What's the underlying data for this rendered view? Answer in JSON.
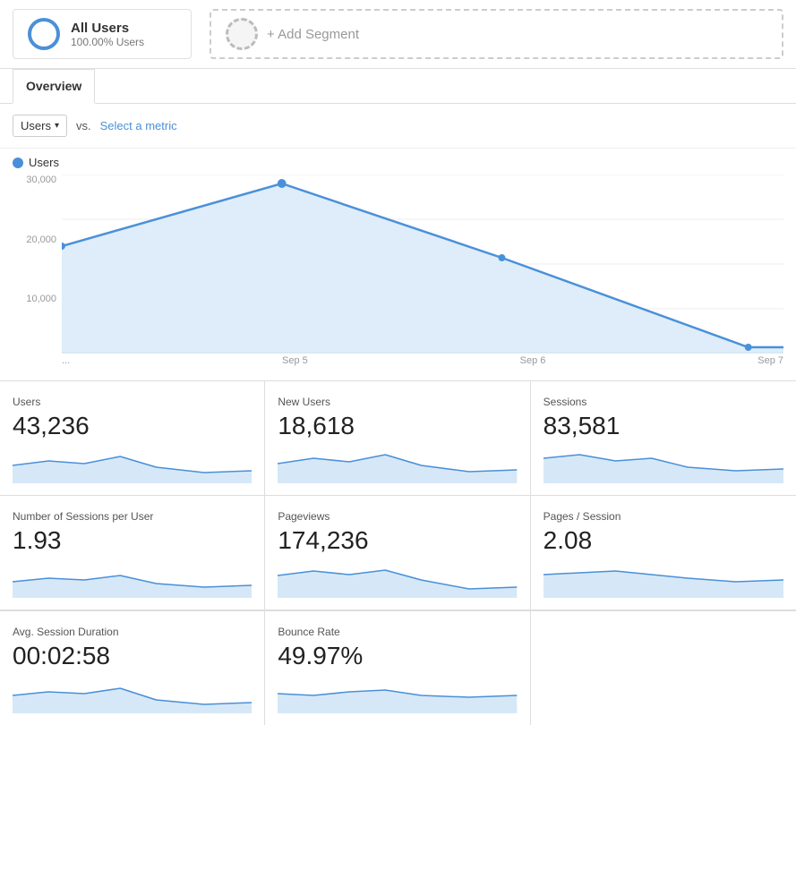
{
  "segments": {
    "all_users": {
      "name": "All Users",
      "pct": "100.00% Users"
    },
    "add_segment_label": "+ Add Segment"
  },
  "tabs": {
    "overview": "Overview"
  },
  "metric_selector": {
    "primary": "Users",
    "vs_label": "vs.",
    "secondary_placeholder": "Select a metric"
  },
  "chart": {
    "legend_label": "Users",
    "y_labels": [
      "30,000",
      "20,000",
      "10,000"
    ],
    "x_labels": [
      "...",
      "Sep 5",
      "Sep 6",
      "Sep 7"
    ]
  },
  "stats": [
    {
      "label": "Users",
      "value": "43,236"
    },
    {
      "label": "New Users",
      "value": "18,618"
    },
    {
      "label": "Sessions",
      "value": "83,581"
    },
    {
      "label": "Number of Sessions per User",
      "value": "1.93"
    },
    {
      "label": "Pageviews",
      "value": "174,236"
    },
    {
      "label": "Pages / Session",
      "value": "2.08"
    }
  ],
  "stats_bottom": [
    {
      "label": "Avg. Session Duration",
      "value": "00:02:58"
    },
    {
      "label": "Bounce Rate",
      "value": "49.97%"
    }
  ],
  "colors": {
    "blue": "#4a90d9",
    "light_blue": "#d6e8f7"
  }
}
